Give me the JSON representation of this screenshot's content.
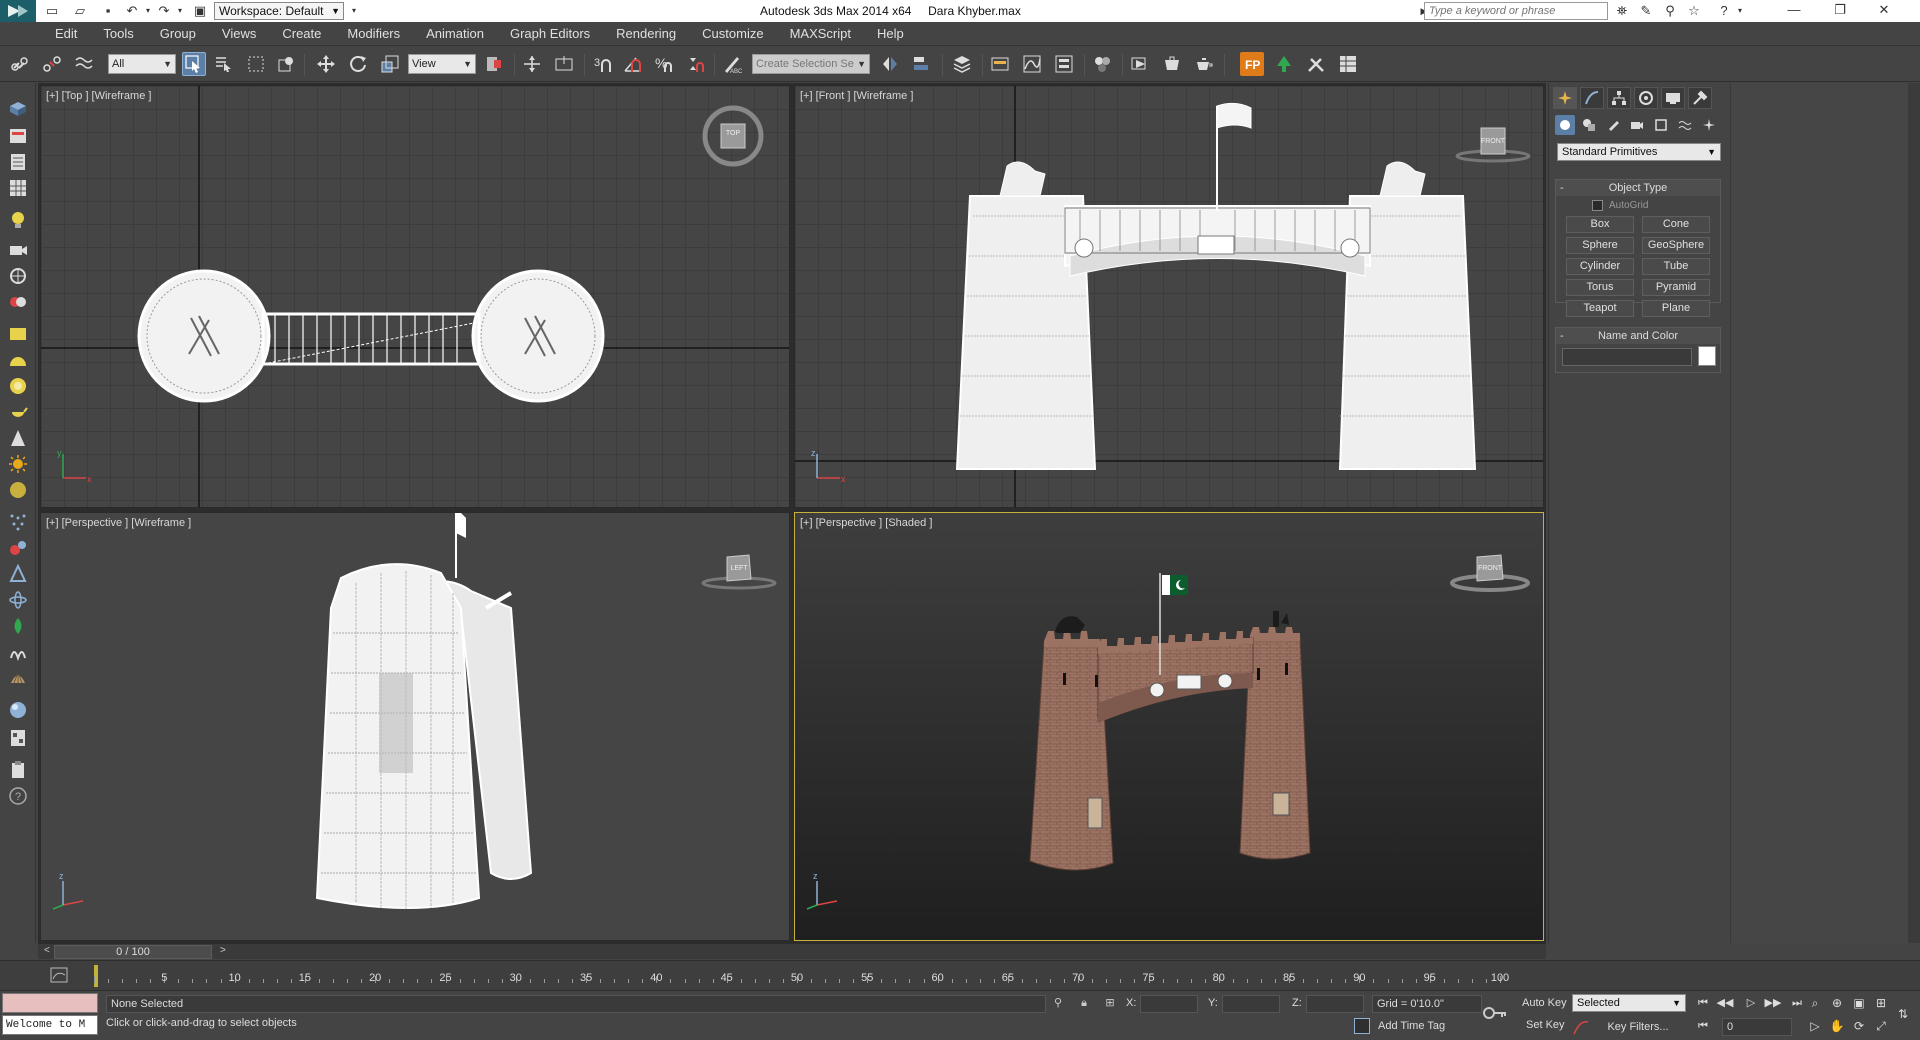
{
  "titlebar": {
    "workspace_label": "Workspace: Default",
    "app_title": "Autodesk 3ds Max  2014 x64",
    "file_name": "Dara Khyber.max",
    "search_placeholder": "Type a keyword or phrase"
  },
  "menu": {
    "items": [
      "Edit",
      "Tools",
      "Group",
      "Views",
      "Create",
      "Modifiers",
      "Animation",
      "Graph Editors",
      "Rendering",
      "Customize",
      "MAXScript",
      "Help"
    ]
  },
  "toolbar": {
    "selection_filter": "All",
    "reference_coord": "View",
    "named_selection_placeholder": "Create Selection Se",
    "snap_angle_label": "3"
  },
  "viewports": {
    "top": {
      "label": "[+] [Top ] [Wireframe ]",
      "cube_label": "TOP"
    },
    "front": {
      "label": "[+] [Front ] [Wireframe ]",
      "cube_label": "FRONT"
    },
    "persp_wire": {
      "label": "[+] [Perspective ] [Wireframe ]",
      "cube_label": "LEFT"
    },
    "persp_shaded": {
      "label": "[+] [Perspective ] [Shaded ]",
      "cube_label": "FRONT"
    },
    "axis_x": "x",
    "axis_y": "y",
    "axis_z": "z"
  },
  "command_panel": {
    "primitive_type": "Standard Primitives",
    "object_type_title": "Object Type",
    "autogrid_label": "AutoGrid",
    "buttons": [
      "Box",
      "Cone",
      "Sphere",
      "GeoSphere",
      "Cylinder",
      "Tube",
      "Torus",
      "Pyramid",
      "Teapot",
      "Plane"
    ],
    "name_color_title": "Name and Color",
    "object_color": "#ffffff"
  },
  "time_slider": {
    "frame_readout": "0 / 100",
    "prev": "<",
    "next": ">"
  },
  "trackbar": {
    "labels": [
      "5",
      "10",
      "15",
      "20",
      "25",
      "30",
      "35",
      "40",
      "45",
      "50",
      "55",
      "60",
      "65",
      "70",
      "75",
      "80",
      "85",
      "90",
      "95",
      "100"
    ]
  },
  "status": {
    "welcome_text": "Welcome to M",
    "selection_text": "None Selected",
    "prompt_text": "Click or click-and-drag to select objects",
    "x_label": "X:",
    "y_label": "Y:",
    "z_label": "Z:",
    "grid_readout": "Grid = 0'10.0\"",
    "add_time_tag": "Add Time Tag",
    "auto_key": "Auto Key",
    "set_key": "Set Key",
    "key_mode": "Selected",
    "key_filters": "Key Filters...",
    "current_frame": "0"
  },
  "colors": {
    "accent_active": "#c9b03d",
    "brand_teal": "#1d5f69",
    "selection_blue": "#5b7fa6",
    "brick": "#9c7263",
    "flag_green": "#0d5c2e"
  }
}
